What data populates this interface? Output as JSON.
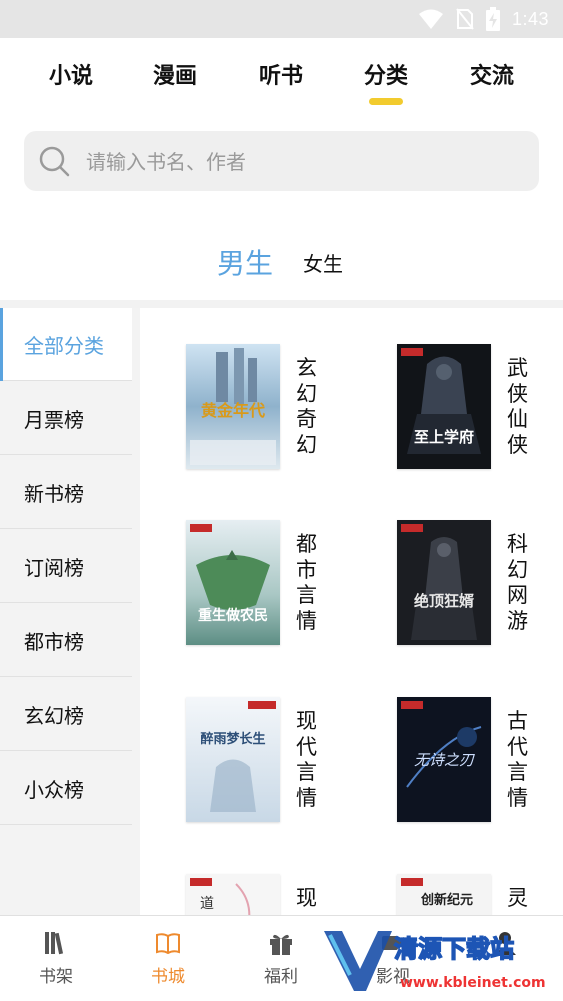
{
  "status_bar": {
    "time": "1:43",
    "icons": [
      "wifi-icon",
      "no-sim-icon",
      "battery-charging-icon"
    ]
  },
  "top_tabs": [
    {
      "label": "小说",
      "active": false
    },
    {
      "label": "漫画",
      "active": false
    },
    {
      "label": "听书",
      "active": false
    },
    {
      "label": "分类",
      "active": true
    },
    {
      "label": "交流",
      "active": false
    }
  ],
  "search": {
    "placeholder": "请输入书名、作者",
    "value": ""
  },
  "gender": {
    "male": "男生",
    "female": "女生",
    "selected": "男生"
  },
  "sidebar": {
    "items": [
      {
        "label": "全部分类",
        "active": true
      },
      {
        "label": "月票榜"
      },
      {
        "label": "新书榜"
      },
      {
        "label": "订阅榜"
      },
      {
        "label": "都市榜"
      },
      {
        "label": "玄幻榜"
      },
      {
        "label": "小众榜"
      }
    ]
  },
  "categories": [
    {
      "label": "玄幻奇幻",
      "cover_title": "黄金年代"
    },
    {
      "label": "武侠仙侠",
      "cover_title": "至上学府"
    },
    {
      "label": "都市言情",
      "cover_title": "重生做农民"
    },
    {
      "label": "科幻网游",
      "cover_title": "绝顶狂婿"
    },
    {
      "label": "现代言情",
      "cover_title": "醉雨梦长生"
    },
    {
      "label": "古代言情",
      "cover_title": "无诗之刃"
    },
    {
      "label": "现",
      "cover_title": "道"
    },
    {
      "label": "灵",
      "cover_title": "创新纪元"
    }
  ],
  "bottom_nav": [
    {
      "label": "书架",
      "icon": "bookshelf-icon",
      "active": false
    },
    {
      "label": "书城",
      "icon": "open-book-icon",
      "active": true
    },
    {
      "label": "福利",
      "icon": "gift-icon",
      "active": false
    },
    {
      "label": "影视",
      "icon": "video-icon",
      "active": false
    },
    {
      "label": "",
      "icon": "profile-icon",
      "active": false
    }
  ],
  "watermark": {
    "title": "清源下载站",
    "url": "www.kbleinet.com"
  },
  "colors": {
    "accent_blue": "#5aa3df",
    "tab_indicator_yellow": "#f2cb2e",
    "nav_active_orange": "#ee8a2e"
  }
}
